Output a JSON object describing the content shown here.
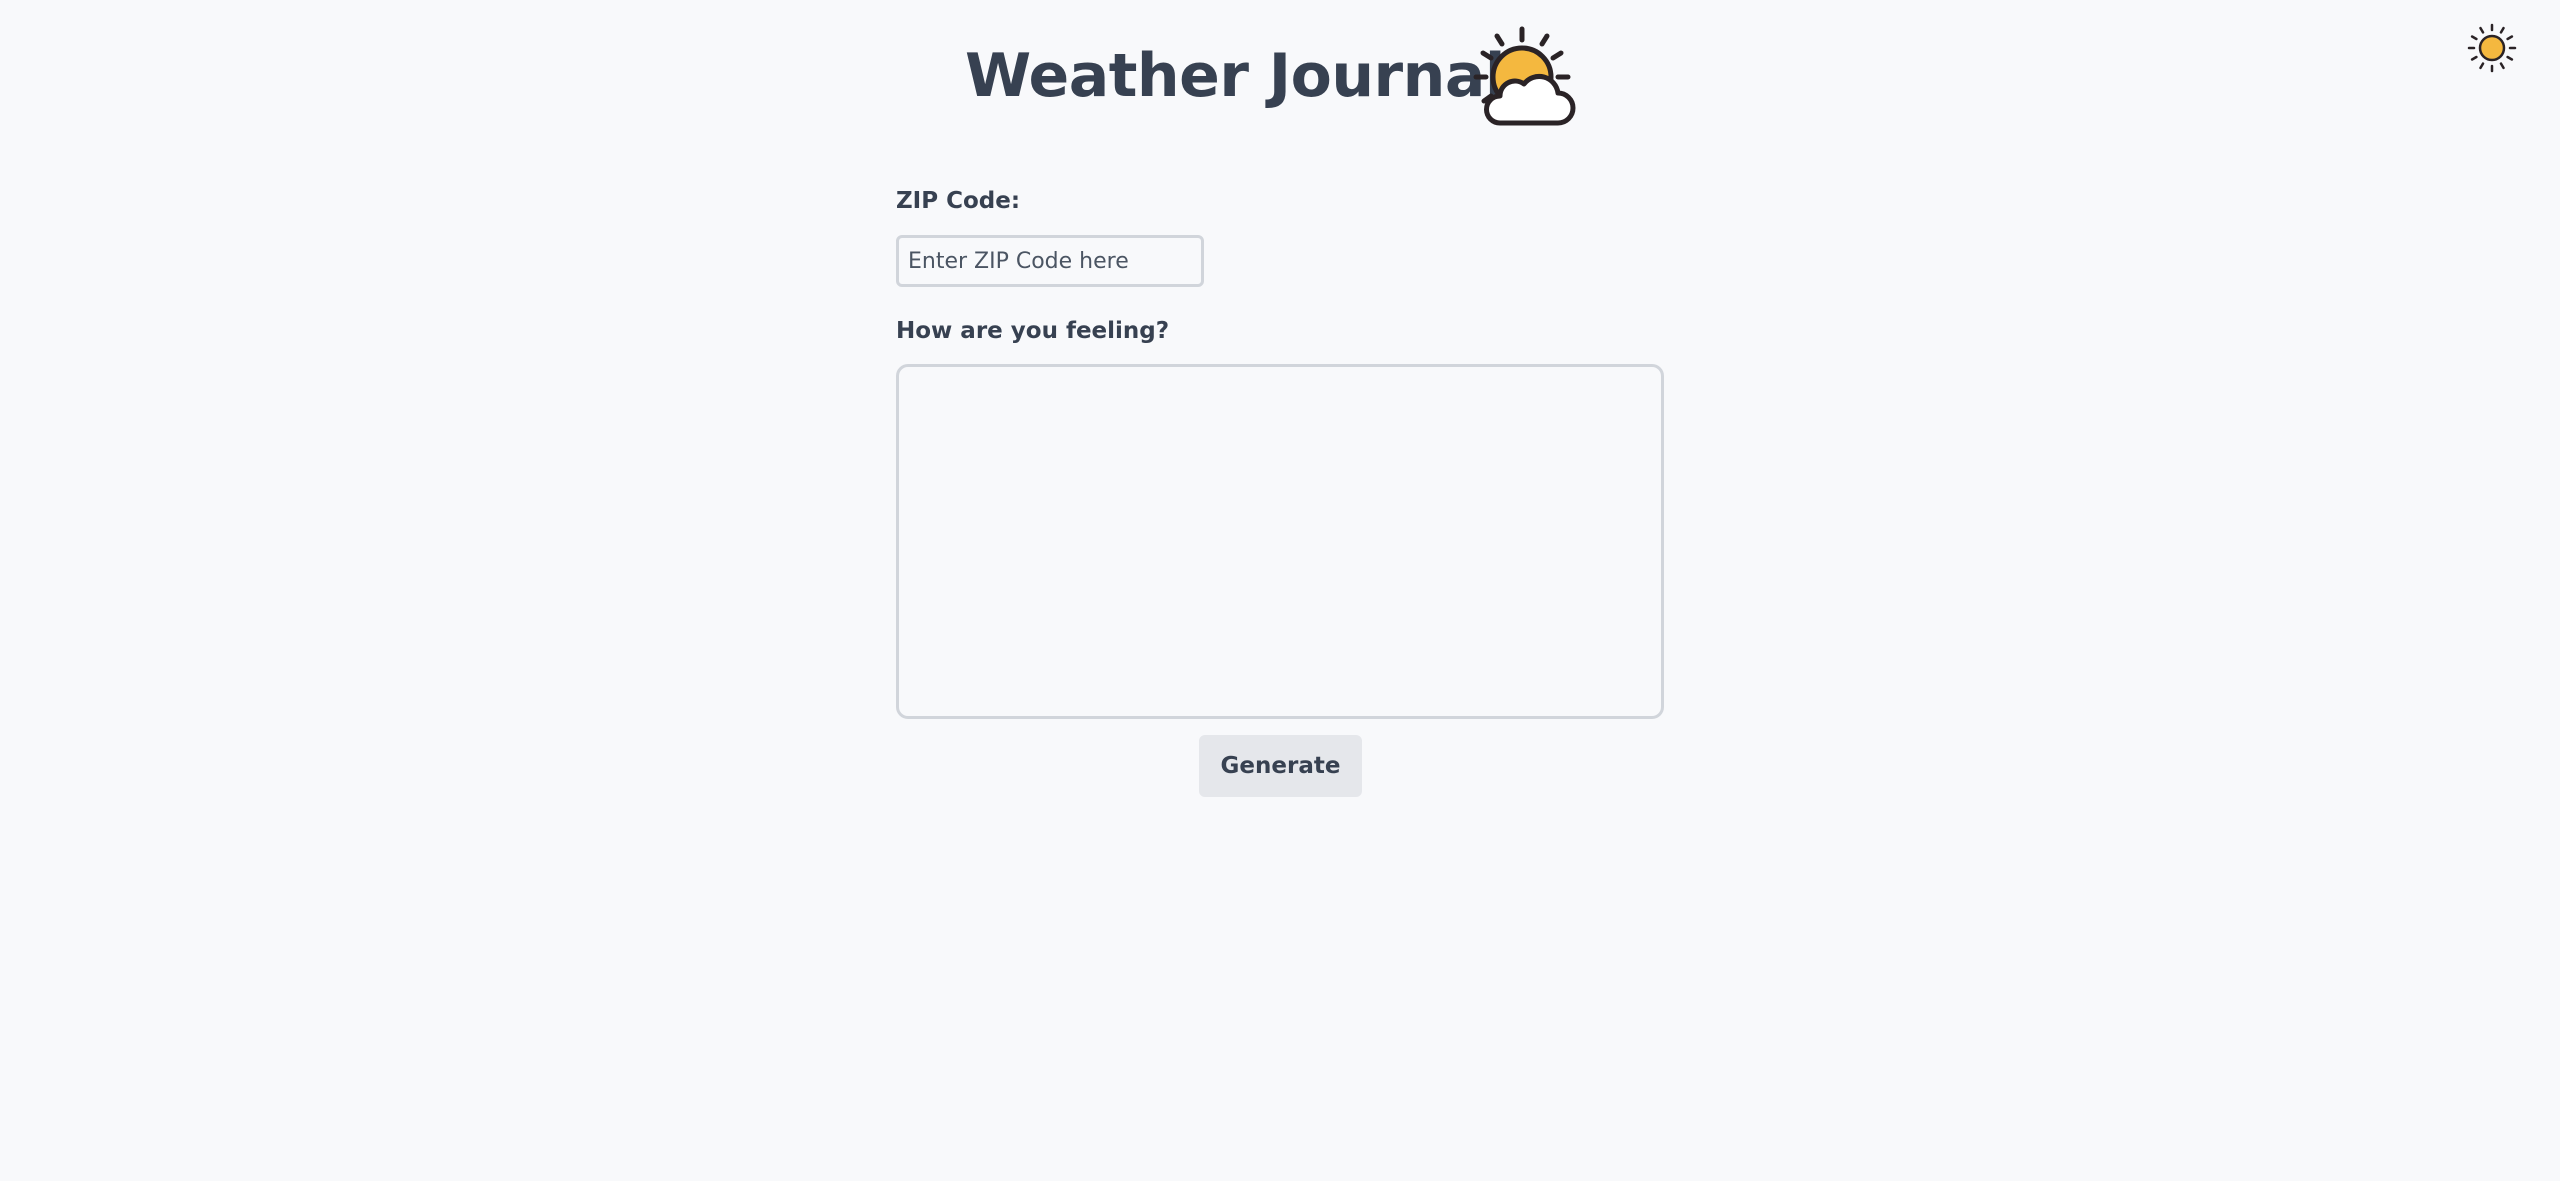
{
  "header": {
    "title": "Weather Journal",
    "title_icon": "sun-behind-cloud-icon",
    "theme_toggle_icon": "sun-icon"
  },
  "form": {
    "zip_label": "ZIP Code:",
    "zip_placeholder": "Enter ZIP Code here",
    "zip_value": "",
    "feelings_label": "How are you feeling?",
    "feelings_value": "",
    "generate_label": "Generate"
  },
  "colors": {
    "background": "#f8f9fb",
    "text": "#374151",
    "sun": "#f4b83f",
    "outline": "#2a2326",
    "input_border": "#d1d5db",
    "button_bg": "#e5e7eb"
  }
}
